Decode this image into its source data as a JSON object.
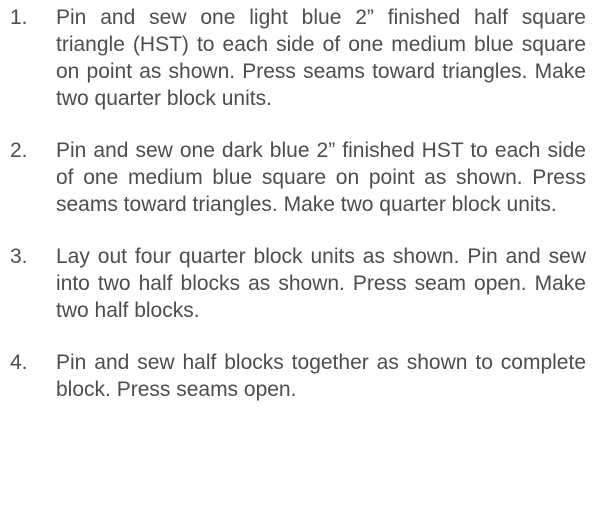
{
  "instructions": {
    "steps": [
      {
        "number": "1.",
        "text": "Pin and sew one light blue 2” finished half square triangle (HST) to each side of one medium blue square on point as shown. Press seams toward triangles.  Make two quarter block units."
      },
      {
        "number": "2.",
        "text": "Pin and sew one dark blue 2” finished HST to each side of one medium blue square on point as shown.  Press seams toward triangles. Make two quarter block units."
      },
      {
        "number": "3.",
        "text": "Lay out four quarter block units as shown. Pin and sew into two half blocks as shown. Press seam open.  Make two half blocks."
      },
      {
        "number": "4.",
        "text": "Pin and sew half blocks together as shown to complete block. Press seams open."
      }
    ]
  }
}
